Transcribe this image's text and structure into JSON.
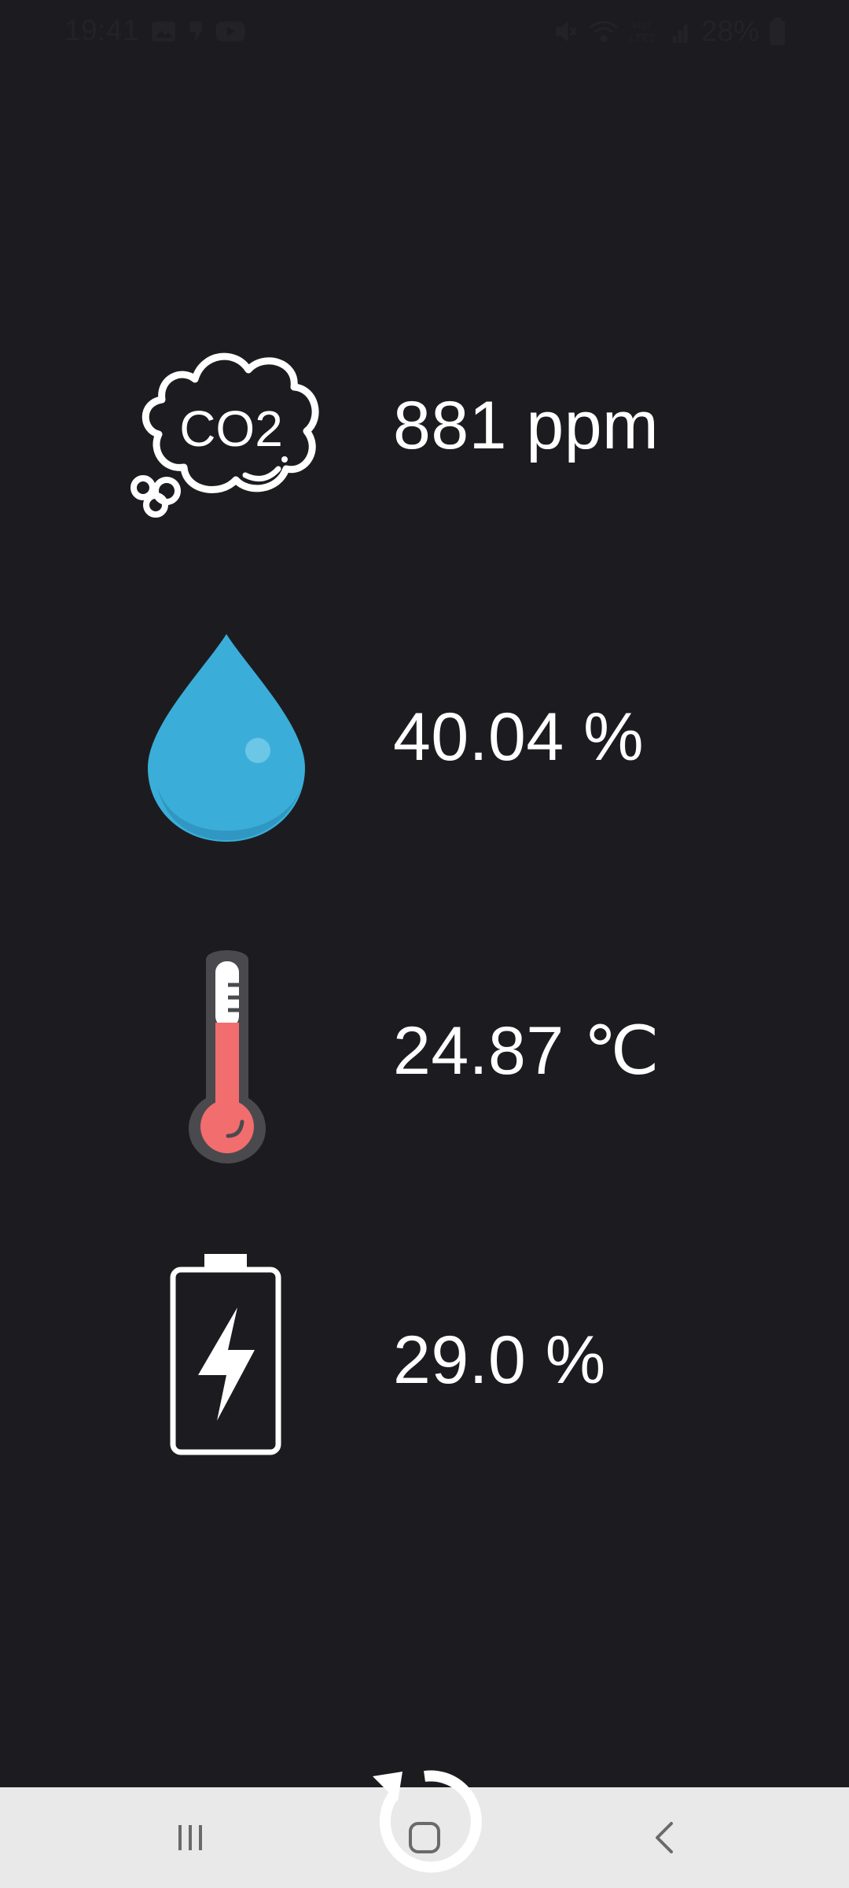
{
  "status_bar": {
    "time": "19:41",
    "battery_percent": "28%",
    "left_icons": [
      "gallery-icon",
      "notification-icon",
      "youtube-icon"
    ],
    "right_icons": [
      "mute-icon",
      "wifi-calling-icon",
      "volte-lte2-icon",
      "signal-icon",
      "battery-icon"
    ],
    "network_label": "Vo))\nLTE2"
  },
  "readings": [
    {
      "name": "co2",
      "icon": "co2-cloud-icon",
      "icon_text": "CO2",
      "value": "881 ppm"
    },
    {
      "name": "humidity",
      "icon": "water-drop-icon",
      "value": "40.04 %"
    },
    {
      "name": "temperature",
      "icon": "thermometer-icon",
      "value": "24.87 ℃"
    },
    {
      "name": "battery",
      "icon": "battery-charging-icon",
      "value": "29.0 %"
    }
  ],
  "nav_bar": {
    "buttons": [
      "recent-apps-icon",
      "home-icon",
      "back-icon"
    ]
  },
  "refresh": {
    "icon": "refresh-icon"
  },
  "colors": {
    "background": "#1c1c20",
    "text": "#ffffff",
    "water": "#3aaed8",
    "thermometer_red": "#f26d6d",
    "thermometer_body": "#4a4a4e",
    "nav_background": "#e9e9e9"
  }
}
